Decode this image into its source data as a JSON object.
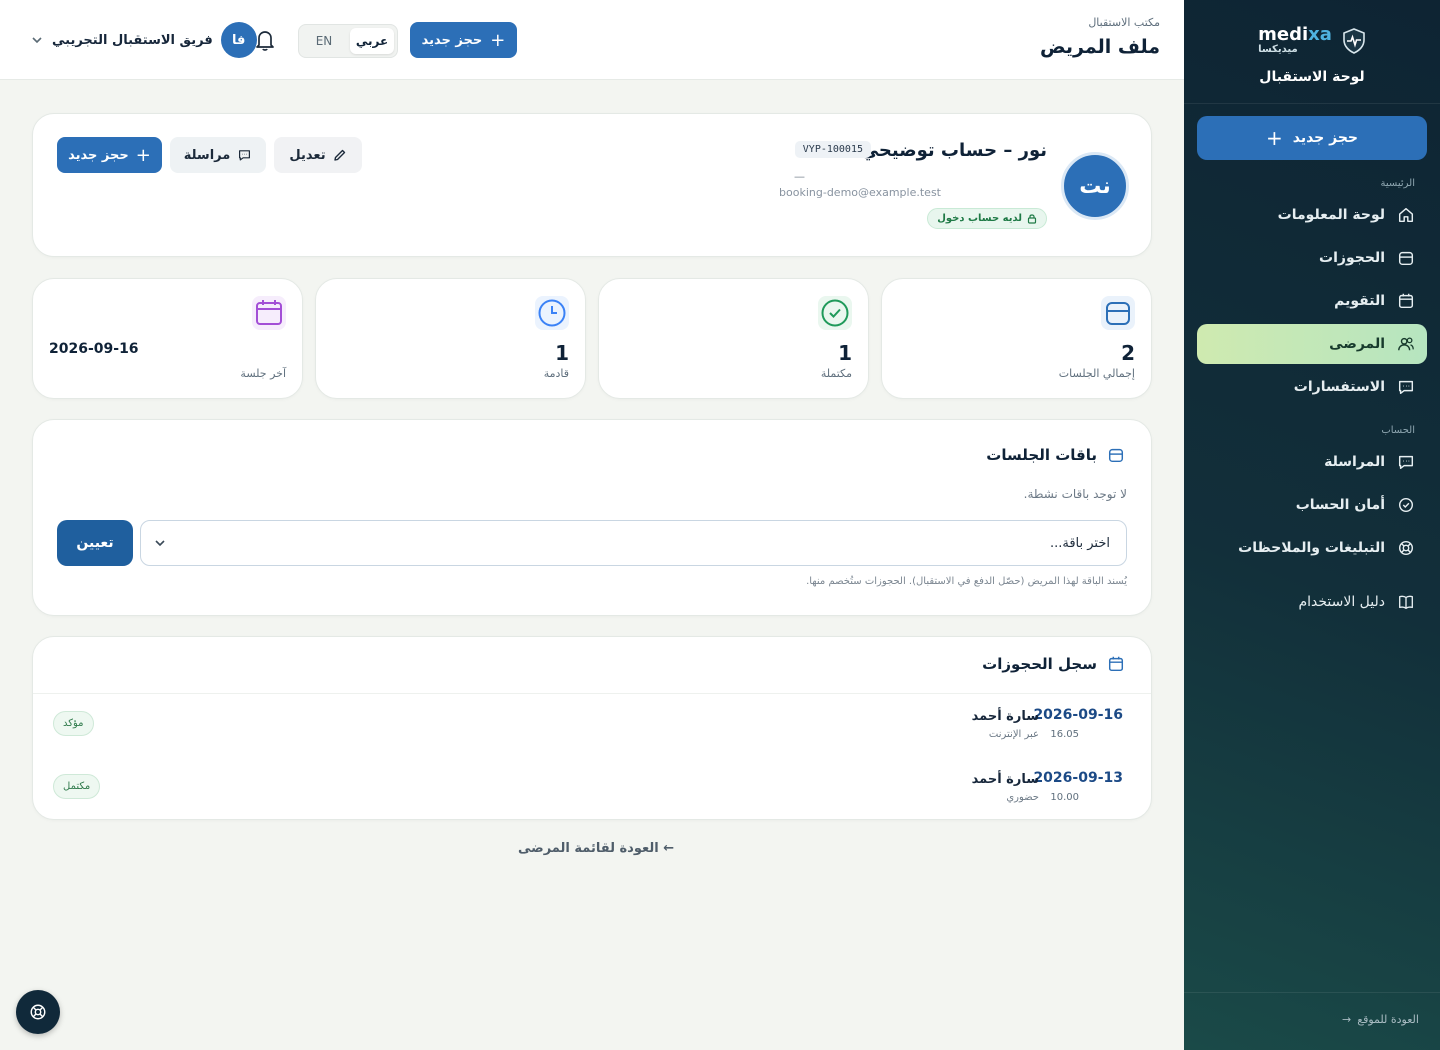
{
  "brand": {
    "name_en_a": "medi",
    "name_en_b": "xa",
    "name_ar": "ميديكسا",
    "panel_title": "لوحة الاستقبال"
  },
  "sidebar": {
    "new_booking": "حجز جديد",
    "section_main": "الرئيسية",
    "section_account": "الحساب",
    "main_items": [
      {
        "label": "لوحة المعلومات",
        "icon": "home-icon"
      },
      {
        "label": "الحجوزات",
        "icon": "briefcase-icon"
      },
      {
        "label": "التقويم",
        "icon": "calendar-icon"
      },
      {
        "label": "المرضى",
        "icon": "users-icon",
        "active": true
      },
      {
        "label": "الاستفسارات",
        "icon": "chat-icon"
      }
    ],
    "account_items": [
      {
        "label": "المراسلة",
        "icon": "chat-icon"
      },
      {
        "label": "أمان الحساب",
        "icon": "check-circle-icon"
      },
      {
        "label": "التبليغات والملاحظات",
        "icon": "lifebuoy-icon"
      }
    ],
    "guide": "دليل الاستخدام",
    "back_to_site": "العودة للموقع"
  },
  "header": {
    "subtitle": "مكتب الاستقبال",
    "title": "ملف المريض",
    "new_booking": "حجز جديد",
    "lang_ar": "عربي",
    "lang_en": "EN",
    "user_initials": "فا",
    "user_name": "فريق الاستقبال التجريبي"
  },
  "patient": {
    "initials": "نت",
    "name": "نور – حساب توضيحي",
    "code": "VYP-100015",
    "phone": "—",
    "email": "booking-demo@example.test",
    "login_badge": "لديه حساب دخول",
    "edit": "تعديل",
    "message": "مراسلة",
    "new_booking": "حجز جديد"
  },
  "stats": [
    {
      "label": "إجمالي الجلسات",
      "value": "2",
      "color": "#2c6fb7"
    },
    {
      "label": "مكتملة",
      "value": "1",
      "color": "#1f9a5a"
    },
    {
      "label": "قادمة",
      "value": "1",
      "color": "#3b82f6"
    },
    {
      "label": "آخر جلسة",
      "value": "2026-09-16",
      "color": "#a34fd6"
    }
  ],
  "packages": {
    "title": "باقات الجلسات",
    "empty": "لا توجد باقات نشطة.",
    "select_value": "اختر باقة...",
    "assign": "تعيين",
    "hint": "يُسند الباقة لهذا المريض (حصّل الدفع في الاستقبال). الحجوزات ستُخصم منها."
  },
  "history": {
    "title": "سجل الحجوزات",
    "rows": [
      {
        "date": "2026-09-16",
        "time": "16.05",
        "name": "سارة أحمد",
        "mode": "عبر الإنترنت",
        "status": "مؤكد"
      },
      {
        "date": "2026-09-13",
        "time": "10.00",
        "name": "سارة أحمد",
        "mode": "حضوري",
        "status": "مكتمل"
      }
    ]
  },
  "back_link": "← العودة لقائمة المرضى"
}
